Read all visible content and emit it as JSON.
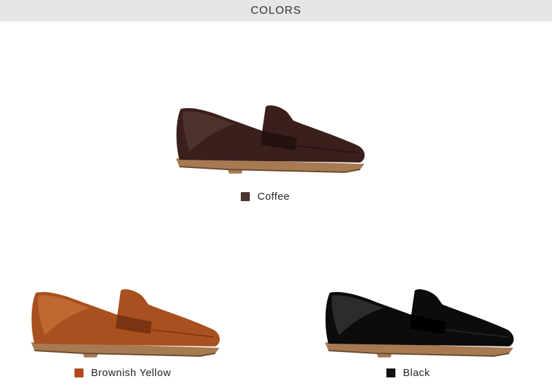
{
  "header": {
    "title": "COLORS"
  },
  "products": [
    {
      "label": "Coffee",
      "swatch_color": "#4a3430",
      "leather": "#3a1f1c",
      "leather_hi": "#5a3a34",
      "leather_dark": "#22110f"
    },
    {
      "label": "Brownish Yellow",
      "swatch_color": "#b04a1c",
      "leather": "#a8501f",
      "leather_hi": "#c8723a",
      "leather_dark": "#7a3412"
    },
    {
      "label": "Black",
      "swatch_color": "#111111",
      "leather": "#0c0c0c",
      "leather_hi": "#3a3a3a",
      "leather_dark": "#000000"
    }
  ]
}
